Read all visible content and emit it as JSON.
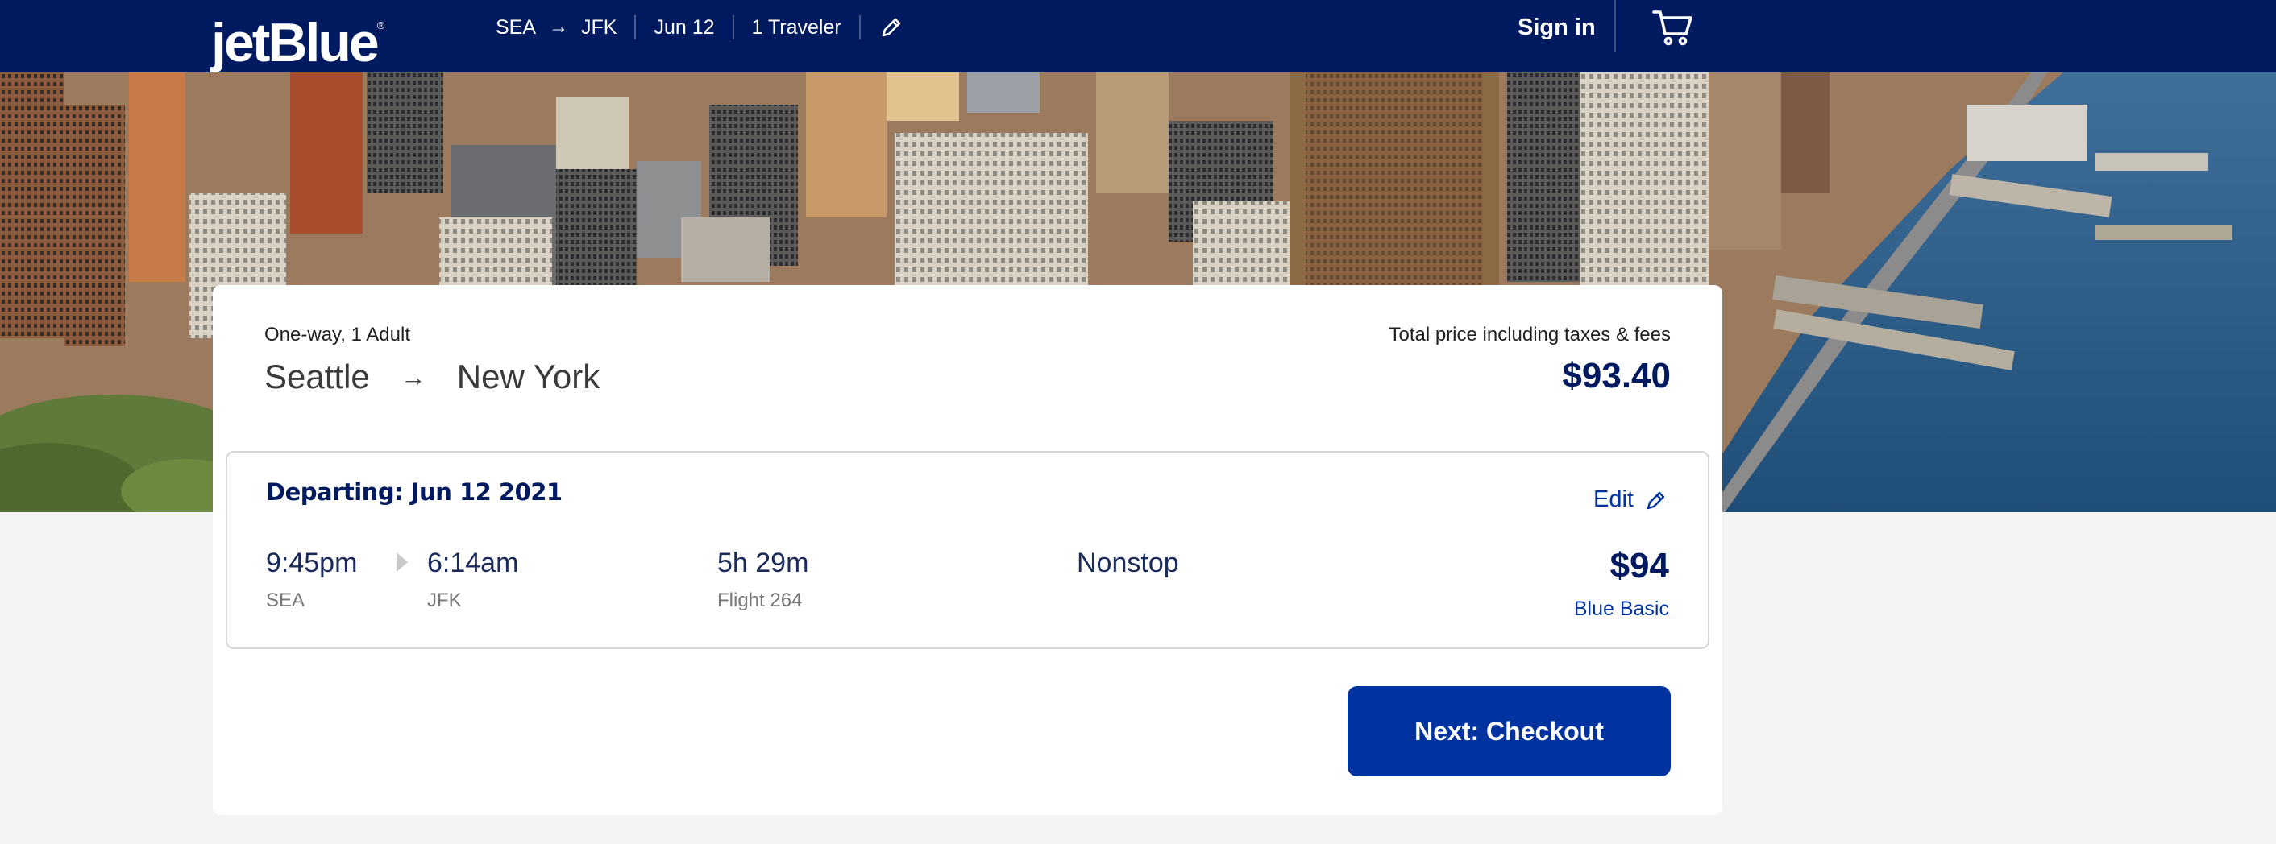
{
  "header": {
    "logo_text": "jetBlue",
    "logo_mark": "®",
    "origin": "SEA",
    "arrow": "→",
    "destination": "JFK",
    "date": "Jun 12",
    "travelers": "1 Traveler",
    "edit_icon": "pencil-icon",
    "signin_label": "Sign in",
    "cart_icon": "cart-icon"
  },
  "summary": {
    "trip_type": "One-way, 1 Adult",
    "origin_city": "Seattle",
    "route_arrow": "→",
    "destination_city": "New York",
    "total_label": "Total price including taxes & fees",
    "total_price": "$93.40"
  },
  "flight": {
    "title": "Departing: Jun 12 2021",
    "edit_label": "Edit",
    "depart_time": "9:45pm",
    "depart_airport": "SEA",
    "arrive_time": "6:14am",
    "arrive_airport": "JFK",
    "duration": "5h 29m",
    "flight_number": "Flight 264",
    "stops": "Nonstop",
    "price": "$94",
    "fare_class": "Blue Basic"
  },
  "actions": {
    "checkout_label": "Next: Checkout"
  },
  "colors": {
    "nav_bg": "#001a60",
    "brand_blue": "#0033a0",
    "page_bg": "#f4f4f4"
  }
}
